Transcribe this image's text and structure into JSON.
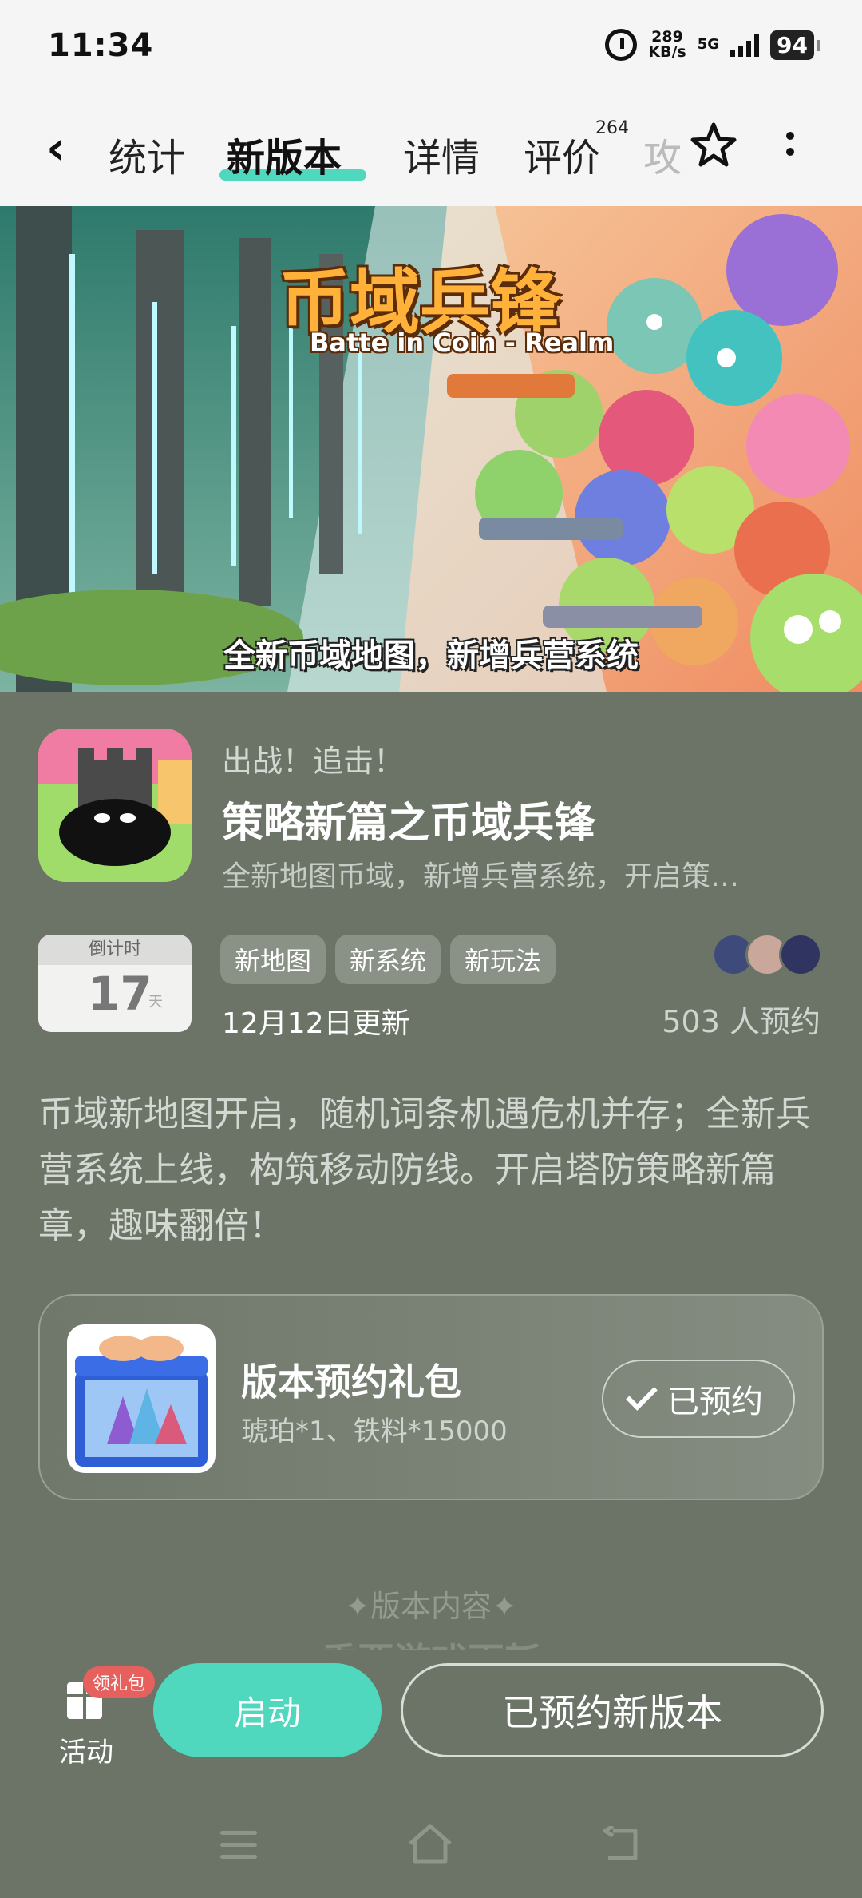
{
  "status_bar": {
    "time": "11:34",
    "speed_value": "289",
    "speed_unit": "KB/s",
    "network": "5G",
    "battery": "94"
  },
  "nav": {
    "back_icon": "chevron-left-icon",
    "tabs": [
      {
        "label": "统计"
      },
      {
        "label": "新版本"
      },
      {
        "label": "详情"
      },
      {
        "label": "评价",
        "badge": "264"
      },
      {
        "label": "攻"
      }
    ],
    "active_tab": "新版本",
    "accent_color": "#4fd8be"
  },
  "banner": {
    "title": "币域兵锋",
    "subtitle": "Batte in Coin - Realm",
    "caption": "全新币域地图，新增兵营系统"
  },
  "game": {
    "slogan": "出战！追击！",
    "title": "策略新篇之币域兵锋",
    "description": "全新地图币域，新增兵营系统，开启策…",
    "countdown_label": "倒计时",
    "countdown_value": "17",
    "countdown_unit": "天",
    "tags": [
      "新地图",
      "新系统",
      "新玩法"
    ],
    "update_date": "12月12日更新",
    "reserve_count": "503 人预约",
    "intro": "币域新地图开启，随机词条机遇危机并存；全新兵营系统上线，构筑移动防线。开启塔防策略新篇章，趣味翻倍！"
  },
  "gift": {
    "title": "版本预约礼包",
    "detail": "琥珀*1、铁料*15000",
    "button_label": "已预约"
  },
  "section": {
    "title": "✦版本内容✦",
    "subtitle": "重要游戏更新"
  },
  "bottom_bar": {
    "activity_label": "活动",
    "activity_badge": "领礼包",
    "launch_label": "启动",
    "reserved_label": "已预约新版本"
  }
}
